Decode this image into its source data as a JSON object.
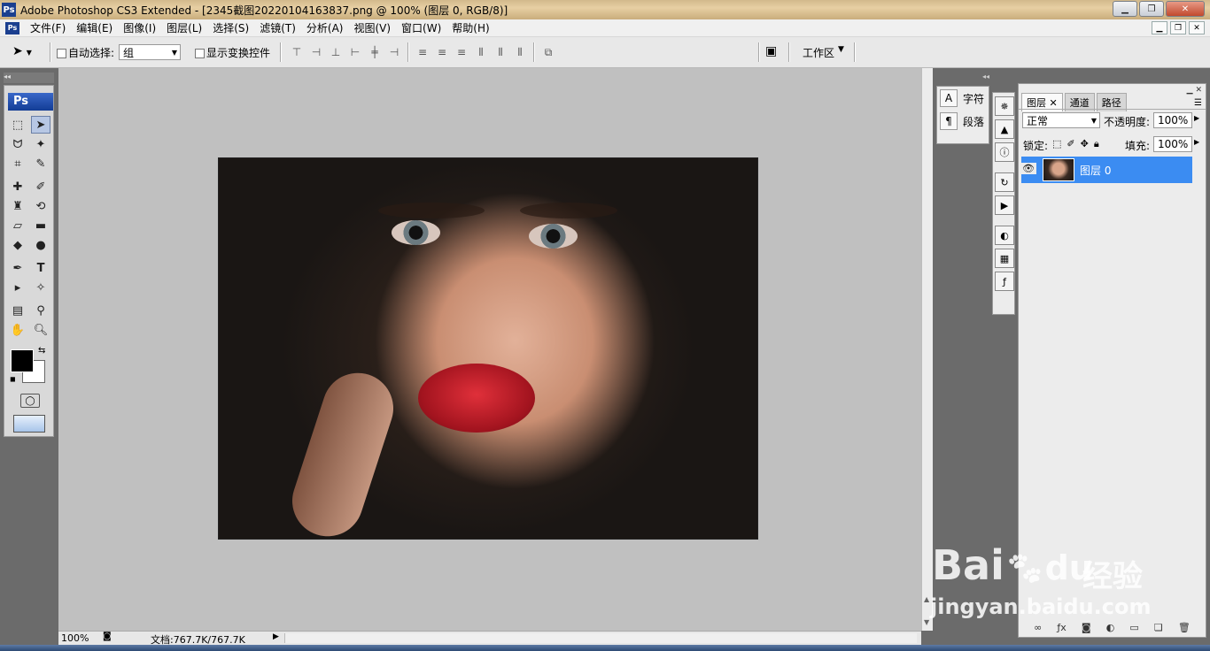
{
  "window": {
    "title": "Adobe Photoshop CS3 Extended - [2345截图20220104163837.png @ 100% (图层 0, RGB/8)]",
    "app_icon_label": "Ps",
    "buttons": {
      "minimize": "▁",
      "maximize": "❐",
      "close": "✕"
    }
  },
  "menubar": {
    "items": [
      "文件(F)",
      "编辑(E)",
      "图像(I)",
      "图层(L)",
      "选择(S)",
      "滤镜(T)",
      "分析(A)",
      "视图(V)",
      "窗口(W)",
      "帮助(H)"
    ],
    "doc_buttons": [
      "▁",
      "❐",
      "✕"
    ]
  },
  "options": {
    "auto_select_label": "自动选择:",
    "auto_select_value": "组",
    "show_transform_label": "显示变换控件",
    "workspace_label": "工作区"
  },
  "tools": {
    "badge": "Ps"
  },
  "status": {
    "zoom": "100%",
    "doc_info": "文档:767.7K/767.7K"
  },
  "char_panel": {
    "character": "字符",
    "paragraph": "段落"
  },
  "layers_panel": {
    "tabs": [
      "图层",
      "通道",
      "路径"
    ],
    "blend_mode": "正常",
    "opacity_label": "不透明度:",
    "opacity_value": "100%",
    "lock_label": "锁定:",
    "fill_label": "填充:",
    "fill_value": "100%",
    "layer_name": "图层 0"
  },
  "watermark": {
    "brand": "Bai",
    "brand_suffix": "du",
    "cn": "经验",
    "url": "jingyan.baidu.com"
  }
}
